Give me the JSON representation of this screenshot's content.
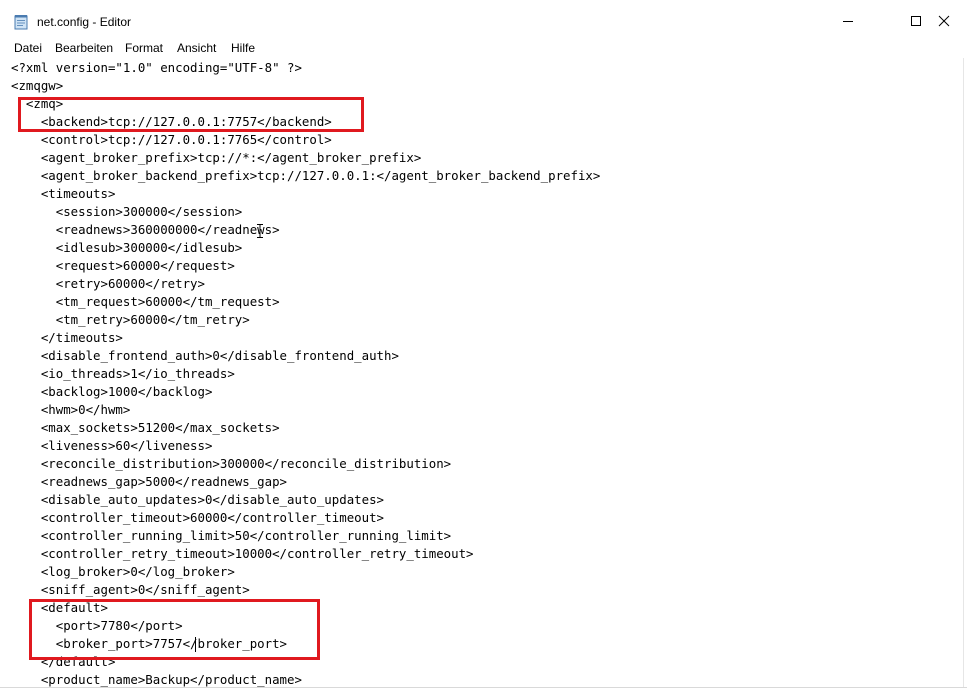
{
  "window": {
    "title": "net.config - Editor"
  },
  "menu": {
    "items": [
      {
        "label": "Datei"
      },
      {
        "label": "Bearbeiten"
      },
      {
        "label": "Format"
      },
      {
        "label": "Ansicht"
      },
      {
        "label": "Hilfe"
      }
    ]
  },
  "editor": {
    "lines": [
      "<?xml version=\"1.0\" encoding=\"UTF-8\" ?>",
      "<zmqgw>",
      "  <zmq>",
      "    <backend>tcp://127.0.0.1:7757</backend>",
      "    <control>tcp://127.0.0.1:7765</control>",
      "    <agent_broker_prefix>tcp://*:</agent_broker_prefix>",
      "    <agent_broker_backend_prefix>tcp://127.0.0.1:</agent_broker_backend_prefix>",
      "    <timeouts>",
      "      <session>300000</session>",
      "      <readnews>360000000</readnews>",
      "      <idlesub>300000</idlesub>",
      "      <request>60000</request>",
      "      <retry>60000</retry>",
      "      <tm_request>60000</tm_request>",
      "      <tm_retry>60000</tm_retry>",
      "    </timeouts>",
      "    <disable_frontend_auth>0</disable_frontend_auth>",
      "    <io_threads>1</io_threads>",
      "    <backlog>1000</backlog>",
      "    <hwm>0</hwm>",
      "    <max_sockets>51200</max_sockets>",
      "    <liveness>60</liveness>",
      "    <reconcile_distribution>300000</reconcile_distribution>",
      "    <readnews_gap>5000</readnews_gap>",
      "    <disable_auto_updates>0</disable_auto_updates>",
      "    <controller_timeout>60000</controller_timeout>",
      "    <controller_running_limit>50</controller_running_limit>",
      "    <controller_retry_timeout>10000</controller_retry_timeout>",
      "    <log_broker>0</log_broker>",
      "    <sniff_agent>0</sniff_agent>",
      "    <default>",
      "      <port>7780</port>",
      "      <broker_port>7757</broker_port>",
      "    </default>",
      "    <product_name>Backup</product_name>"
    ]
  },
  "colors": {
    "highlight": "#e0191f",
    "text": "#000000",
    "background": "#ffffff"
  }
}
